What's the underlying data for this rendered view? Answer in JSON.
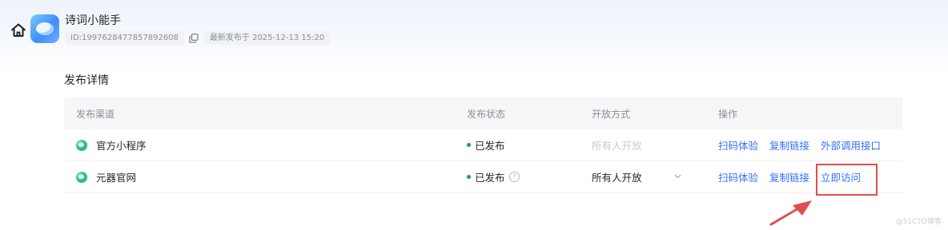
{
  "header": {
    "app_title": "诗词小能手",
    "app_id": "ID:1997628477857892608",
    "latest_publish": "最新发布于 2025-12-13 15:20"
  },
  "section": {
    "title": "发布详情"
  },
  "table": {
    "headers": [
      "发布渠道",
      "发布状态",
      "开放方式",
      "操作"
    ],
    "rows": [
      {
        "channel": "官方小程序",
        "status": "已发布",
        "access": "所有人开放",
        "actions": [
          "扫码体验",
          "复制链接",
          "外部调用接口"
        ]
      },
      {
        "channel": "元器官网",
        "status": "已发布",
        "access": "所有人开放",
        "actions": [
          "扫码体验",
          "复制链接",
          "立即访问"
        ]
      }
    ]
  },
  "help_glyph": "?",
  "watermark": "@51CTO博客",
  "colors": {
    "accent": "#3370ff",
    "status_published": "#12a150",
    "annotation": "#e34d4d"
  },
  "icons": [
    "home-icon",
    "app-logo",
    "copy-icon",
    "channel-icon",
    "help-icon",
    "chevron-down-icon",
    "arrow-annotation"
  ]
}
